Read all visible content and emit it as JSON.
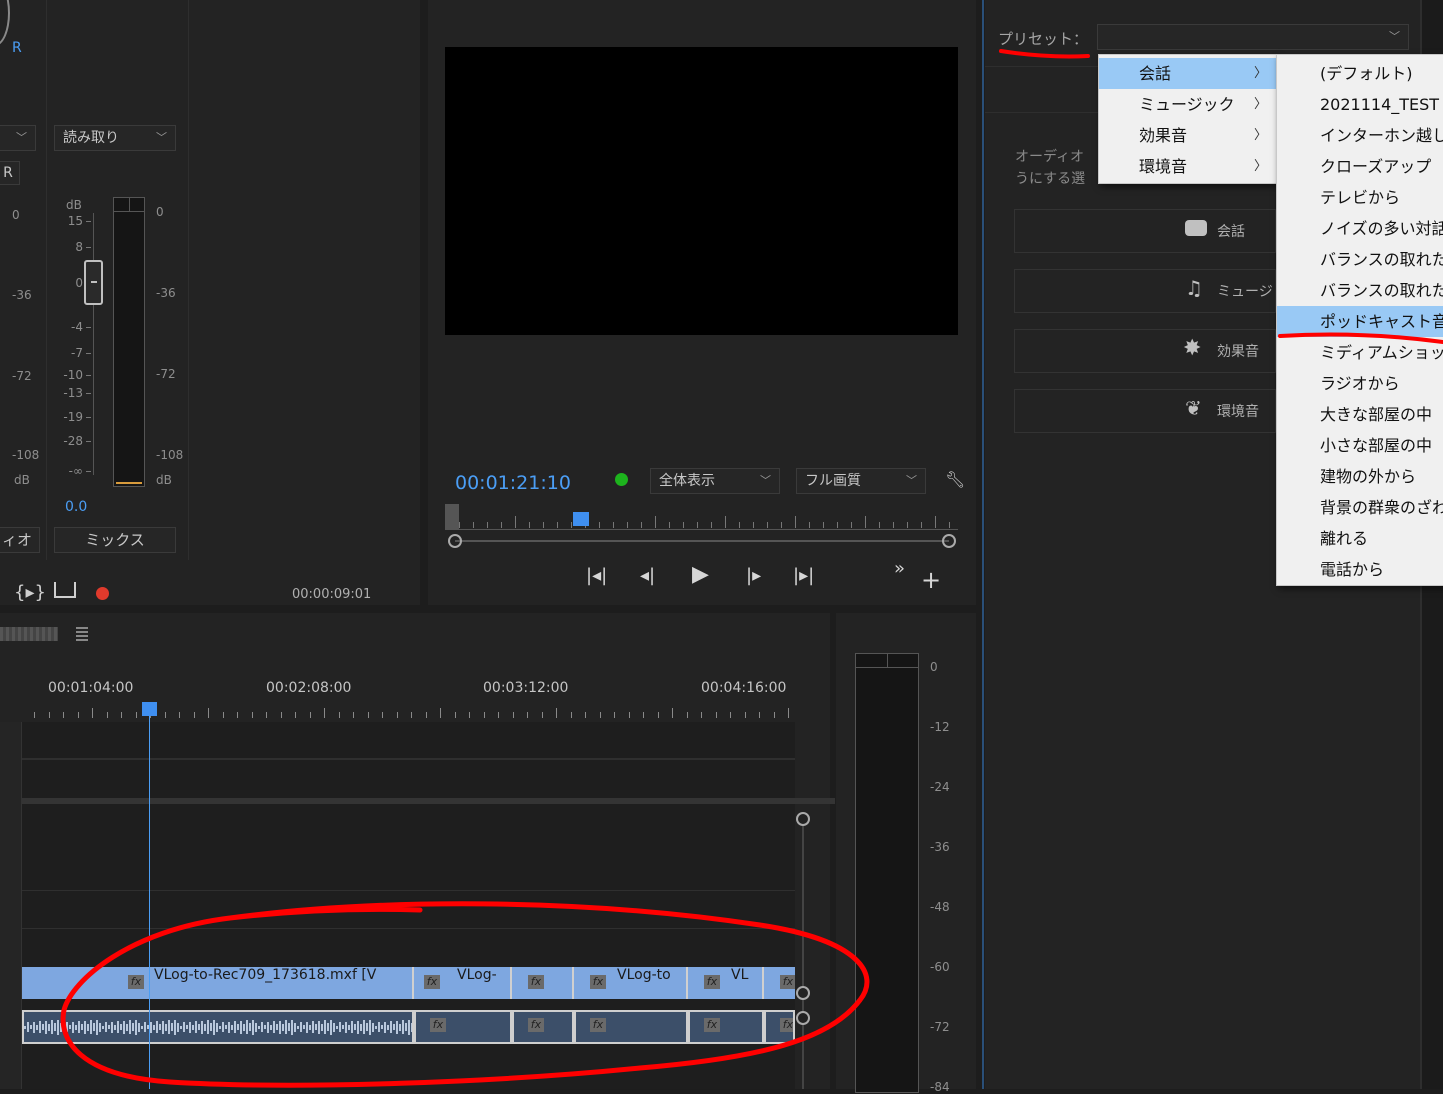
{
  "mixer": {
    "ch_letter": "R",
    "read_mode": "読み取り",
    "r_btn": "R",
    "db_unit": "dB",
    "fader_ticks": [
      "15",
      "8",
      "0",
      "-4",
      "-7",
      "-10",
      "-13",
      "-19",
      "-28",
      "-∞"
    ],
    "meter_ticks": [
      "0",
      "-36",
      "-72",
      "-108"
    ],
    "left_meter_ticks": [
      "0",
      "-36",
      "-72",
      "-108"
    ],
    "volume": "0.0",
    "mix_label": "ミックス",
    "audio_cut": "ィオ",
    "timecode": "00:00:09:01"
  },
  "program": {
    "timecode": "00:01:21:10",
    "zoom": "全体表示",
    "quality": "フル画質",
    "controls": [
      "mark-in",
      "step-back",
      "play",
      "step-forward",
      "mark-out"
    ]
  },
  "timeline": {
    "ruler": [
      "00:01:04:00",
      "00:02:08:00",
      "00:03:12:00",
      "00:04:16:00"
    ],
    "clips": [
      {
        "label": "VLog-to-Rec709_173618.mxf [V"
      },
      {
        "label": "VLog-"
      },
      {
        "label": ""
      },
      {
        "label": "VLog-to"
      },
      {
        "label": "VL"
      },
      {
        "label": ""
      }
    ],
    "fx": "fx"
  },
  "meters": {
    "ticks": [
      "0",
      "-12",
      "-24",
      "-36",
      "-48",
      "-60",
      "-72",
      "-84"
    ]
  },
  "essential_sound": {
    "preset_label": "プリセット：",
    "desc_line1": "オーディオ",
    "desc_line2": "うにする選",
    "type_buttons": [
      "会話",
      "ミュージ",
      "効果音",
      "環境音"
    ]
  },
  "preset_menu": {
    "categories": [
      "会話",
      "ミュージック",
      "効果音",
      "環境音"
    ],
    "items": [
      "(デフォルト)",
      "2021114_TEST",
      "インターホン越し",
      "クローズアップ",
      "テレビから",
      "ノイズの多い対話",
      "バランスの取れた女",
      "バランスの取れた男",
      "ポッドキャスト音声",
      "ミディアムショット",
      "ラジオから",
      "大きな部屋の中",
      "小さな部屋の中",
      "建物の外から",
      "背景の群衆のざわ",
      "離れる",
      "電話から"
    ],
    "selected_index": 8
  },
  "colors": {
    "accent": "#4b9ef5",
    "annotation": "#ff0000",
    "menu_highlight": "#99c9f5"
  }
}
